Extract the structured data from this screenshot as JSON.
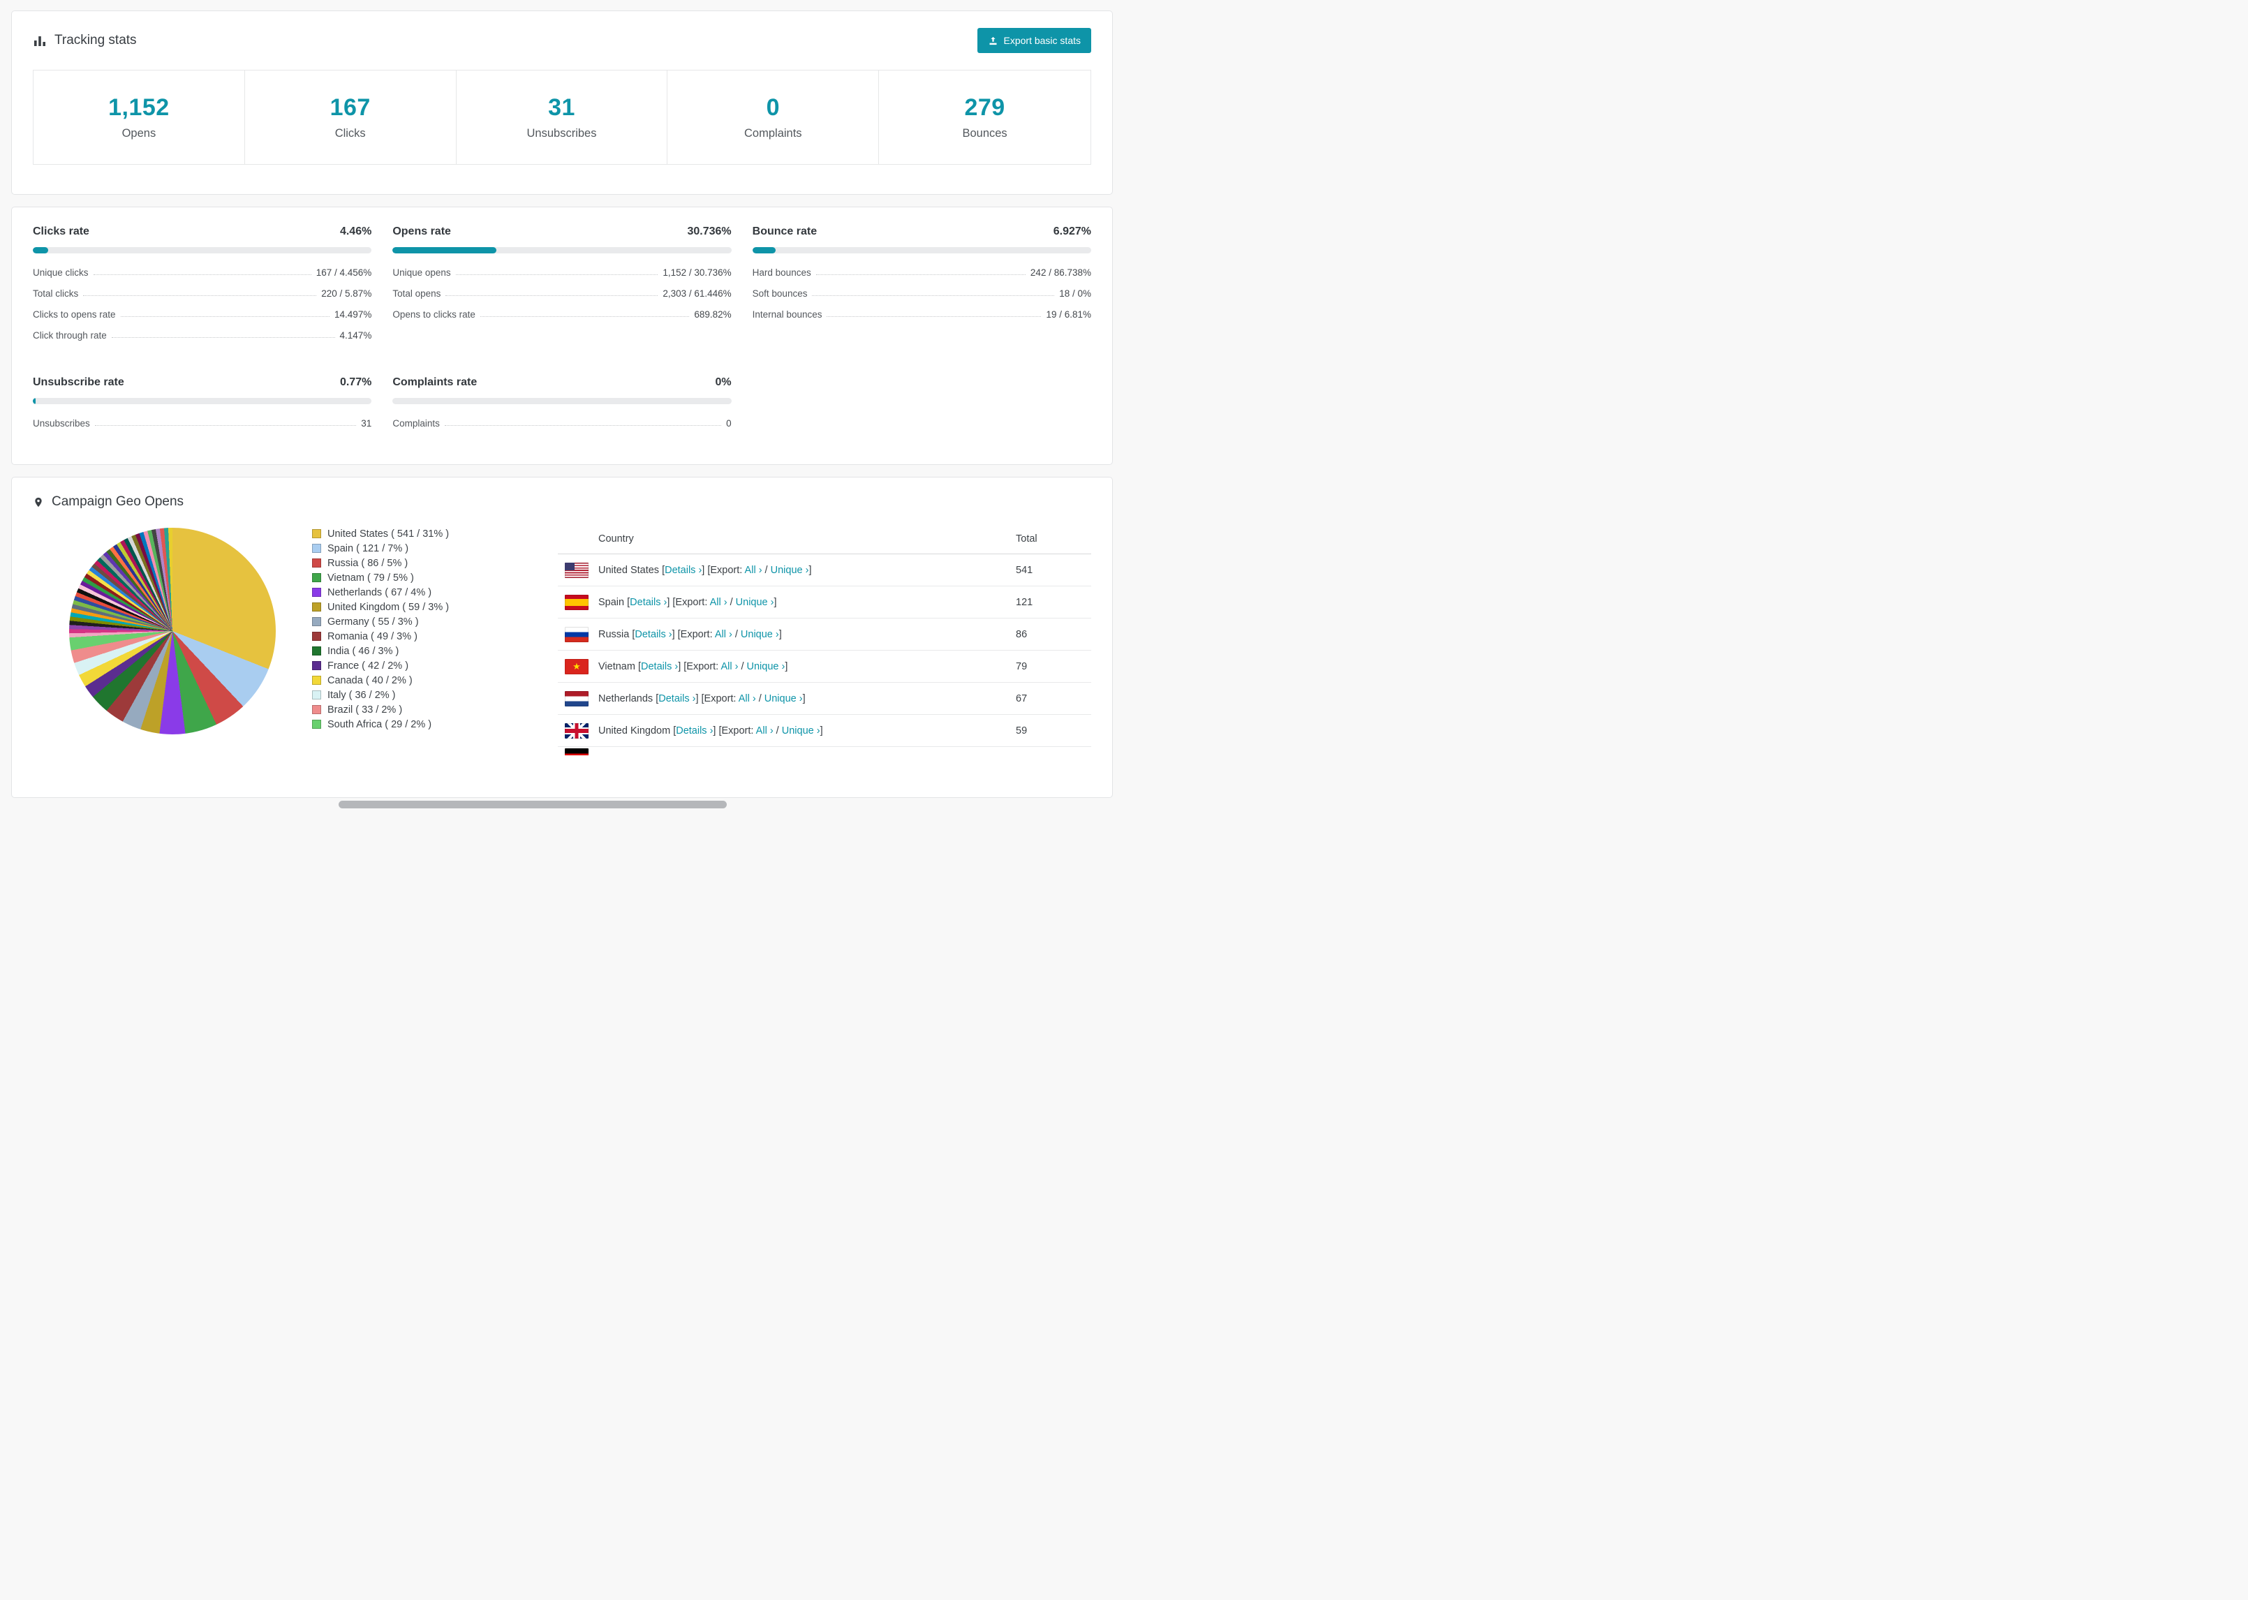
{
  "colors": {
    "accent": "#0e94a8",
    "bar_track": "#e9eaec"
  },
  "tracking": {
    "title": "Tracking stats",
    "export_button": "Export basic stats",
    "stats": [
      {
        "value": "1,152",
        "label": "Opens"
      },
      {
        "value": "167",
        "label": "Clicks"
      },
      {
        "value": "31",
        "label": "Unsubscribes"
      },
      {
        "value": "0",
        "label": "Complaints"
      },
      {
        "value": "279",
        "label": "Bounces"
      }
    ]
  },
  "rates": {
    "panels": [
      {
        "title": "Clicks rate",
        "value": "4.46%",
        "percent": 4.46,
        "rows": [
          {
            "label": "Unique clicks",
            "value": "167 / 4.456%"
          },
          {
            "label": "Total clicks",
            "value": "220 / 5.87%"
          },
          {
            "label": "Clicks to opens rate",
            "value": "14.497%"
          },
          {
            "label": "Click through rate",
            "value": "4.147%"
          }
        ]
      },
      {
        "title": "Opens rate",
        "value": "30.736%",
        "percent": 30.736,
        "rows": [
          {
            "label": "Unique opens",
            "value": "1,152 / 30.736%"
          },
          {
            "label": "Total opens",
            "value": "2,303 / 61.446%"
          },
          {
            "label": "Opens to clicks rate",
            "value": "689.82%"
          }
        ]
      },
      {
        "title": "Bounce rate",
        "value": "6.927%",
        "percent": 6.927,
        "rows": [
          {
            "label": "Hard bounces",
            "value": "242 / 86.738%"
          },
          {
            "label": "Soft bounces",
            "value": "18 / 0%"
          },
          {
            "label": "Internal bounces",
            "value": "19 / 6.81%"
          }
        ]
      },
      {
        "title": "Unsubscribe rate",
        "value": "0.77%",
        "percent": 0.77,
        "rows": [
          {
            "label": "Unsubscribes",
            "value": "31"
          }
        ]
      },
      {
        "title": "Complaints rate",
        "value": "0%",
        "percent": 0,
        "rows": [
          {
            "label": "Complaints",
            "value": "0"
          }
        ]
      }
    ]
  },
  "geo": {
    "title": "Campaign Geo Opens",
    "table": {
      "headers": [
        "Country",
        "Total"
      ],
      "links": {
        "details": "Details ›",
        "all": "All ›",
        "unique": "Unique ›",
        "export_prefix": "Export:"
      },
      "rows": [
        {
          "flag": "us",
          "country": "United States",
          "total": "541"
        },
        {
          "flag": "es",
          "country": "Spain",
          "total": "121"
        },
        {
          "flag": "ru",
          "country": "Russia",
          "total": "86"
        },
        {
          "flag": "vn",
          "country": "Vietnam",
          "total": "79"
        },
        {
          "flag": "nl",
          "country": "Netherlands",
          "total": "67"
        },
        {
          "flag": "gb",
          "country": "United Kingdom",
          "total": "59"
        },
        {
          "flag": "de",
          "country": "",
          "total": "",
          "partial": true
        }
      ]
    }
  },
  "chart_data": {
    "type": "pie",
    "title": "Campaign Geo Opens",
    "legend_position": "right",
    "slices": [
      {
        "label": "United States",
        "value": 541,
        "pct": 31,
        "color": "#e6c23f"
      },
      {
        "label": "Spain",
        "value": 121,
        "pct": 7,
        "color": "#a9cdf0"
      },
      {
        "label": "Russia",
        "value": 86,
        "pct": 5,
        "color": "#cf4a47"
      },
      {
        "label": "Vietnam",
        "value": 79,
        "pct": 5,
        "color": "#3fa64a"
      },
      {
        "label": "Netherlands",
        "value": 67,
        "pct": 4,
        "color": "#8a3be8"
      },
      {
        "label": "United Kingdom",
        "value": 59,
        "pct": 3,
        "color": "#bda128"
      },
      {
        "label": "Germany",
        "value": 55,
        "pct": 3,
        "color": "#96aabf"
      },
      {
        "label": "Romania",
        "value": 49,
        "pct": 3,
        "color": "#9d3a3a"
      },
      {
        "label": "India",
        "value": 46,
        "pct": 3,
        "color": "#20762f"
      },
      {
        "label": "France",
        "value": 42,
        "pct": 2,
        "color": "#5b2d90"
      },
      {
        "label": "Canada",
        "value": 40,
        "pct": 2,
        "color": "#f2d838"
      },
      {
        "label": "Italy",
        "value": 36,
        "pct": 2,
        "color": "#d9f2f4"
      },
      {
        "label": "Brazil",
        "value": 33,
        "pct": 2,
        "color": "#ef8c8c"
      },
      {
        "label": "South Africa",
        "value": 29,
        "pct": 2,
        "color": "#69d06f"
      }
    ],
    "other_slice_colors": [
      "#f2a7c3",
      "#d63384",
      "#8e44ad",
      "#1f1f1f",
      "#7f8c00",
      "#00a8b5",
      "#f39c12",
      "#5d6d7e",
      "#7dba46",
      "#2e4da0",
      "#e74c3c",
      "#101010",
      "#f7c6d9",
      "#6a1b9a",
      "#2e9e44",
      "#8e1c1c",
      "#f5e04a",
      "#2980d9",
      "#6d4c41",
      "#c2185b",
      "#00695c",
      "#9e9e9e",
      "#5e35b1",
      "#3e6b1f",
      "#ff7043",
      "#283593",
      "#c0ca33",
      "#ad1457",
      "#00564d",
      "#d7d7d7",
      "#7a7120",
      "#7b0c44",
      "#0277bd",
      "#f48fb1",
      "#57b55c",
      "#444444",
      "#b085c9",
      "#e05752",
      "#2ba193",
      "#e8cf2e"
    ]
  }
}
